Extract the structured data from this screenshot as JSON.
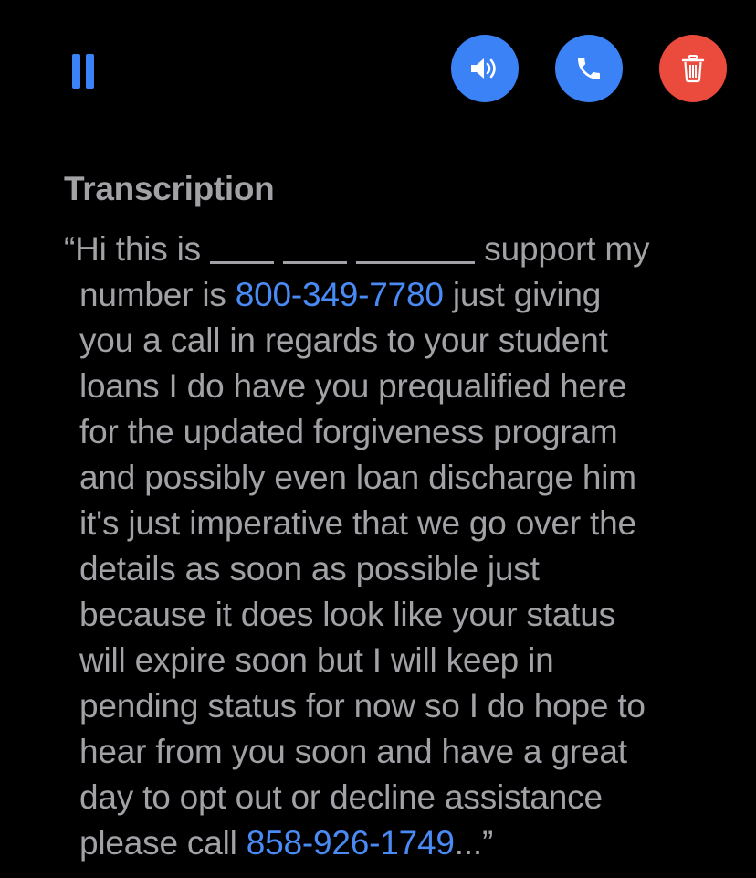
{
  "toolbar": {
    "pause": {
      "icon": "pause-icon",
      "color": "#3a82f6"
    },
    "speaker": {
      "icon": "speaker-icon",
      "color": "#3a82f6"
    },
    "call": {
      "icon": "phone-icon",
      "color": "#3a82f6"
    },
    "delete": {
      "icon": "trash-icon",
      "color": "#ea4b3d"
    }
  },
  "transcription": {
    "heading": "Transcription",
    "line1_a": "“Hi this is",
    "line1_b": "support my",
    "line2_a": "number is ",
    "phone1": "800-349-7780",
    "line2_b": " just giving",
    "line3": "you a call in regards to your student",
    "line4": "loans I do have you prequalified here",
    "line5": "for the updated forgiveness program",
    "line6": "and possibly even loan discharge him",
    "line7": "it's just imperative that we go over the",
    "line8": "details as soon as possible just",
    "line9": "because it does look like your status",
    "line10": "will expire soon but I will keep in",
    "line11": "pending status for now so I do hope to",
    "line12": "hear from you soon and have a great",
    "line13": "day to opt out or decline assistance",
    "line14_a": "please call ",
    "phone2": "858-926-1749",
    "line14_b": "...”"
  },
  "colors": {
    "background": "#000000",
    "text": "#a1a1a6",
    "link": "#4a8af5",
    "accent": "#3a82f6",
    "danger": "#ea4b3d"
  }
}
